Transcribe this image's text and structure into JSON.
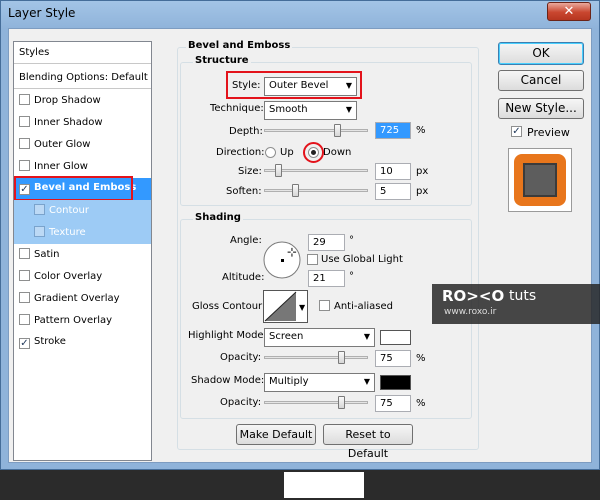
{
  "window": {
    "title": "Layer Style",
    "close_glyph": "✕"
  },
  "styles_panel": {
    "header": "Styles",
    "blending": "Blending Options: Default",
    "items": [
      {
        "label": "Drop Shadow",
        "checked": false
      },
      {
        "label": "Inner Shadow",
        "checked": false
      },
      {
        "label": "Outer Glow",
        "checked": false
      },
      {
        "label": "Inner Glow",
        "checked": false
      },
      {
        "label": "Bevel and Emboss",
        "checked": true,
        "selected": true
      },
      {
        "label": "Contour",
        "checked": false,
        "sub": true
      },
      {
        "label": "Texture",
        "checked": false,
        "sub": true
      },
      {
        "label": "Satin",
        "checked": false
      },
      {
        "label": "Color Overlay",
        "checked": false
      },
      {
        "label": "Gradient Overlay",
        "checked": false
      },
      {
        "label": "Pattern Overlay",
        "checked": false
      },
      {
        "label": "Stroke",
        "checked": true
      }
    ]
  },
  "bevel": {
    "section_title": "Bevel and Emboss",
    "structure": {
      "title": "Structure",
      "style_label": "Style:",
      "style_value": "Outer Bevel",
      "technique_label": "Technique:",
      "technique_value": "Smooth",
      "depth_label": "Depth:",
      "depth_value": "725",
      "depth_unit": "%",
      "direction_label": "Direction:",
      "up_label": "Up",
      "down_label": "Down",
      "direction_selected": "down",
      "size_label": "Size:",
      "size_value": "10",
      "size_unit": "px",
      "soften_label": "Soften:",
      "soften_value": "5",
      "soften_unit": "px"
    },
    "shading": {
      "title": "Shading",
      "angle_label": "Angle:",
      "angle_value": "29",
      "angle_unit": "°",
      "global_light_label": "Use Global Light",
      "global_light_checked": false,
      "altitude_label": "Altitude:",
      "altitude_value": "21",
      "altitude_unit": "°",
      "gloss_label": "Gloss Contour:",
      "anti_aliased_label": "Anti-aliased",
      "anti_aliased_checked": false,
      "highlight_label": "Highlight Mode:",
      "highlight_value": "Screen",
      "highlight_color": "#ffffff",
      "highlight_opacity_label": "Opacity:",
      "highlight_opacity": "75",
      "shadow_label": "Shadow Mode:",
      "shadow_value": "Multiply",
      "shadow_color": "#000000",
      "shadow_opacity_label": "Opacity:",
      "shadow_opacity": "75",
      "pct": "%"
    },
    "make_default": "Make Default",
    "reset_default": "Reset to Default"
  },
  "actions": {
    "ok": "OK",
    "cancel": "Cancel",
    "new_style": "New Style...",
    "preview_label": "Preview",
    "preview_checked": true
  },
  "watermark": {
    "logo": "RO><O",
    "suffix": "tuts",
    "url": "www.roxo.ir"
  },
  "colors": {
    "accent_select": "#3399ff",
    "highlight_red": "#e3131b",
    "preview_orange": "#e8761c"
  }
}
